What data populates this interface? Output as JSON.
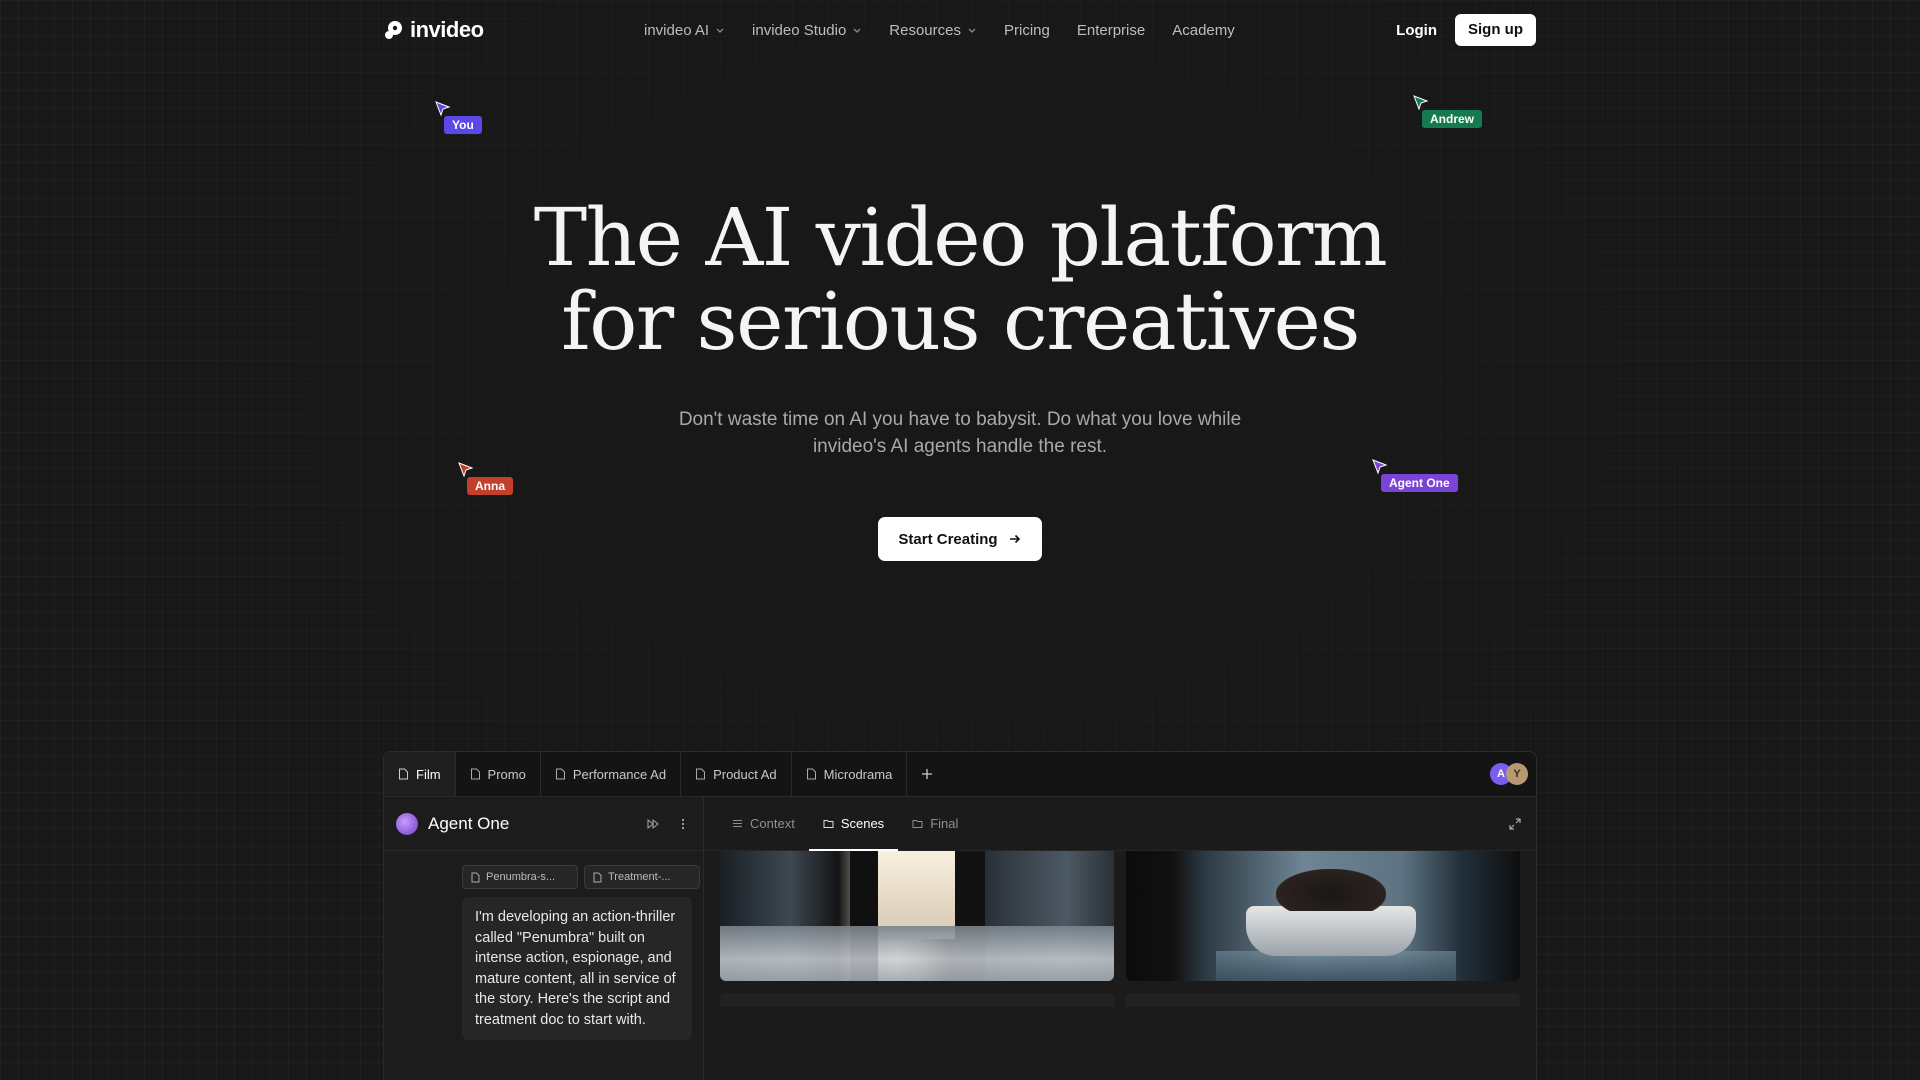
{
  "brand": {
    "name": "invideo"
  },
  "nav": {
    "links": [
      {
        "label": "invideo AI",
        "dropdown": true
      },
      {
        "label": "invideo Studio",
        "dropdown": true
      },
      {
        "label": "Resources",
        "dropdown": true
      },
      {
        "label": "Pricing",
        "dropdown": false
      },
      {
        "label": "Enterprise",
        "dropdown": false
      },
      {
        "label": "Academy",
        "dropdown": false
      }
    ],
    "login": "Login",
    "signup": "Sign up"
  },
  "cursors": [
    {
      "label": "You",
      "color": "#5b48e8"
    },
    {
      "label": "Andrew",
      "color": "#157a4e"
    },
    {
      "label": "Anna",
      "color": "#c2402b"
    },
    {
      "label": "Agent One",
      "color": "#7a45d6"
    }
  ],
  "hero": {
    "title_line1": "The AI video platform",
    "title_line2": "for serious creatives",
    "subtitle": "Don't waste time on AI you have to babysit. Do what you love while invideo's AI agents handle the rest.",
    "cta": "Start Creating"
  },
  "app": {
    "tabs": [
      {
        "label": "Film",
        "active": true
      },
      {
        "label": "Promo",
        "active": false
      },
      {
        "label": "Performance Ad",
        "active": false
      },
      {
        "label": "Product Ad",
        "active": false
      },
      {
        "label": "Microdrama",
        "active": false
      }
    ],
    "avatars": [
      "A",
      "Y"
    ],
    "agent": {
      "name": "Agent One"
    },
    "attachments": [
      "Penumbra-s...",
      "Treatment-..."
    ],
    "message": "I'm developing an action-thriller called \"Penumbra\" built on intense action, espionage, and mature content, all in service of the story. Here's the script and treatment doc to start with.",
    "subtabs": [
      {
        "label": "Context",
        "icon": "list-icon",
        "active": false
      },
      {
        "label": "Scenes",
        "icon": "folder-icon",
        "active": true
      },
      {
        "label": "Final",
        "icon": "folder-icon",
        "active": false
      }
    ]
  }
}
